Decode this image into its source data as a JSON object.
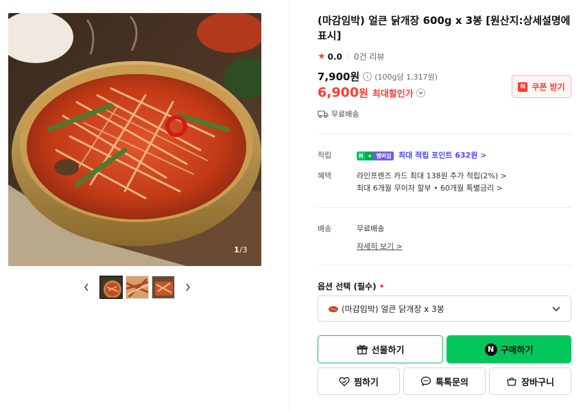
{
  "product": {
    "title": "(마감임박) 얼큰 닭개장 600g x 3봉 [원산지:상세설명에 표시]",
    "rating_score": "0.0",
    "review_count": "0건 리뷰",
    "original_price": "7,900원",
    "unit_price": "(100g당 1,317원)",
    "sale_price": "6,900",
    "sale_unit": "원",
    "sale_label": "최대할인가",
    "coupon_label": "쿠폰 받기",
    "shipping_label": "무료배송"
  },
  "gallery": {
    "counter_current": "1",
    "counter_total": "/3",
    "thumbnails": 3,
    "active_index": 0
  },
  "details": {
    "points": {
      "key": "적립",
      "membership_a": "N",
      "membership_b": "멤버십",
      "value": "최대 적립 포인트 632원 >"
    },
    "benefits": {
      "key": "혜택",
      "line1": "라인프렌즈 카드 최대 138원 추가 적립(2%) >",
      "line2": "최대 6개월 무이자 할부 • 60개월 특별금리 >"
    },
    "delivery": {
      "key": "배송",
      "value": "무료배송",
      "detail_link": "자세히 보기 >"
    }
  },
  "options": {
    "title": "옵션 선택 (필수)",
    "required_mark": "•",
    "selected": "(마감임박) 얼큰 닭개장 x 3봉"
  },
  "actions": {
    "gift": "선물하기",
    "buy": "구매하기",
    "buy_badge": "N",
    "wish": "찜하기",
    "talk": "톡톡문의",
    "cart": "장바구니"
  },
  "colors": {
    "accent_green": "#03c75a",
    "sale_red": "#ff3b30",
    "point_blue": "#4b47ff"
  }
}
